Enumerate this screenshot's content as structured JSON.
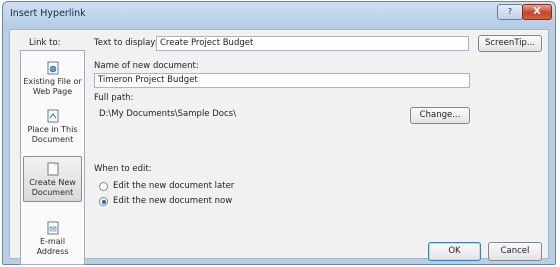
{
  "title": "Insert Hyperlink",
  "title_buttons": {
    "help": "?",
    "close": "X"
  },
  "link_to_label": "Link to:",
  "nav": [
    {
      "label_1": "Existing File or",
      "label_2": "Web Page",
      "icon": "globe-file-icon"
    },
    {
      "label_1": "Place in This",
      "label_2": "Document",
      "icon": "document-place-icon"
    },
    {
      "label_1": "Create New",
      "label_2": "Document",
      "icon": "new-document-icon",
      "selected": true
    },
    {
      "label_1": "E-mail Address",
      "label_2": "",
      "icon": "email-icon"
    }
  ],
  "text_to_display": {
    "label": "Text to display:",
    "value": "Create Project Budget"
  },
  "screentip_button": "ScreenTip...",
  "new_document": {
    "label": "Name of new document:",
    "value": "Timeron Project Budget"
  },
  "full_path": {
    "label": "Full path:",
    "value": "D:\\My Documents\\Sample Docs\\"
  },
  "change_button": "Change...",
  "when_to_edit": {
    "label": "When to edit:",
    "options": [
      {
        "label": "Edit the new document later",
        "checked": false
      },
      {
        "label": "Edit the new document now",
        "checked": true
      }
    ]
  },
  "ok_button": "OK",
  "cancel_button": "Cancel"
}
